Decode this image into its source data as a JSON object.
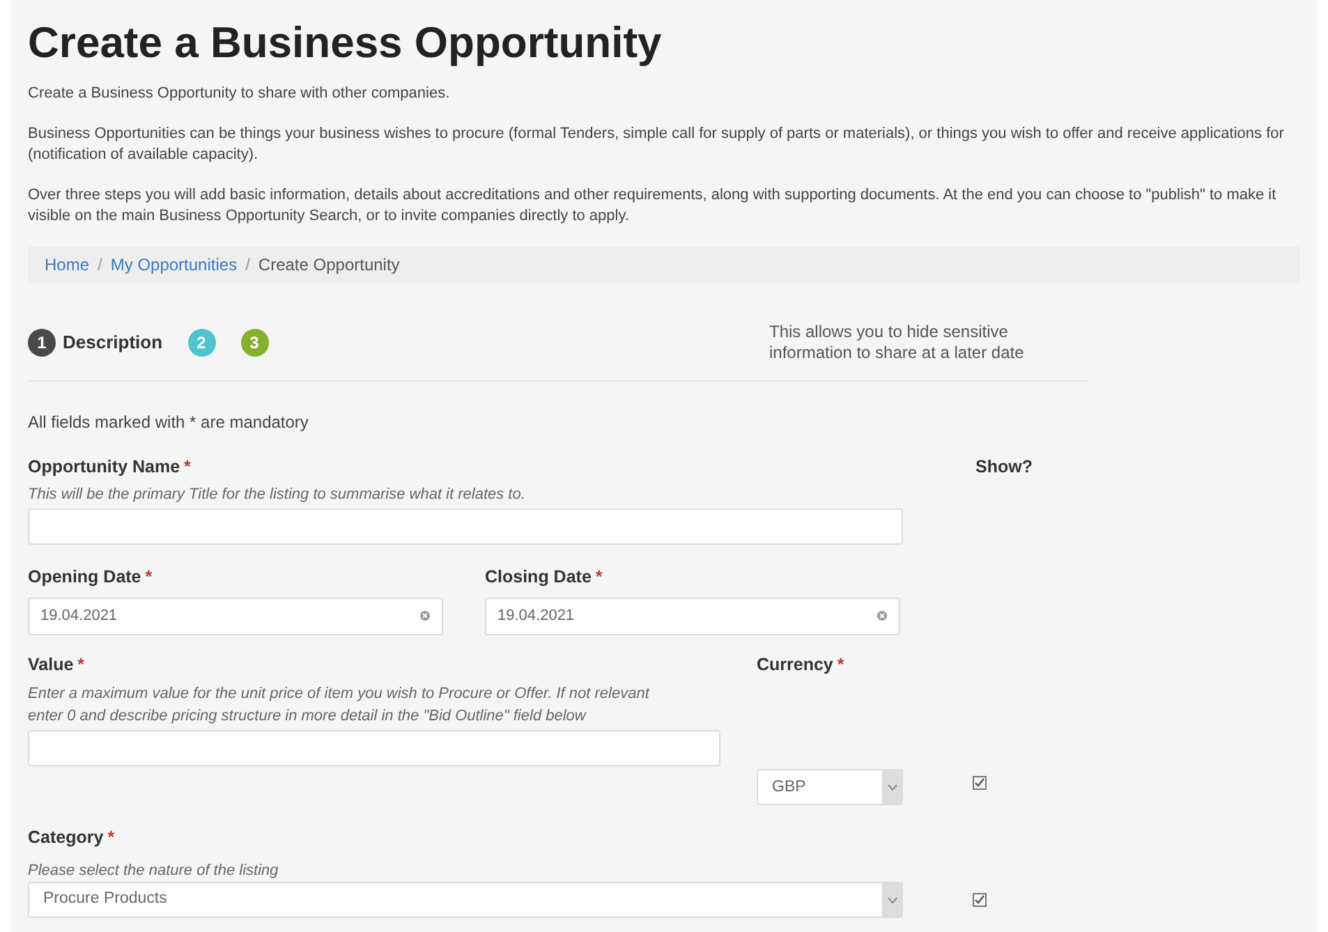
{
  "title": "Create a Business Opportunity",
  "intro": [
    "Create a Business Opportunity to share with other companies.",
    "Business Opportunities can be things your business wishes to procure (formal Tenders, simple call for supply of parts or materials), or things you wish to offer and receive applications for (notification of available capacity).",
    "Over three steps you will add basic information, details about accreditations and other requirements, along with supporting documents. At the end you can choose to \"publish\" to make it visible on the main Business Opportunity Search, or to invite companies directly to apply."
  ],
  "breadcrumb": [
    {
      "label": "Home",
      "link": true,
      "separator": "/"
    },
    {
      "label": "My Opportunities",
      "link": true,
      "separator": "/"
    },
    {
      "label": "Create Opportunity",
      "link": false
    }
  ],
  "steps": [
    {
      "number": "1",
      "label": "Description",
      "color": "#4a4a4a"
    },
    {
      "number": "2",
      "color": "#4fc3d0"
    },
    {
      "number": "3",
      "color": "#86b12a"
    }
  ],
  "side_note": "This allows you to hide sensitive information to share at a later date",
  "mandatory_note": "All fields marked with * are mandatory",
  "show_heading": "Show?",
  "fields": [
    {
      "kind": "text",
      "label": "Opportunity Name",
      "mark": "*",
      "hint": "This will be the primary Title for the listing to summarise what it relates to."
    },
    {
      "kind": "dates",
      "items": [
        {
          "label": "Opening Date",
          "mark": "*",
          "value": "19.04.2021"
        },
        {
          "label": "Closing Date",
          "mark": "*",
          "value": "19.04.2021"
        }
      ]
    },
    {
      "kind": "value",
      "label": "Value",
      "mark": "*",
      "hint": "Enter a maximum value for the unit price of item you wish to Procure or Offer. If not relevant enter 0 and describe pricing structure in more detail in the \"Bid Outline\" field below",
      "currency": {
        "label": "Currency",
        "mark": "*",
        "value": "GBP"
      },
      "show": true
    },
    {
      "kind": "select",
      "label": "Category",
      "mark": "*",
      "hint": "Please select the nature of the listing",
      "value": "Procure Products",
      "show": true
    }
  ]
}
